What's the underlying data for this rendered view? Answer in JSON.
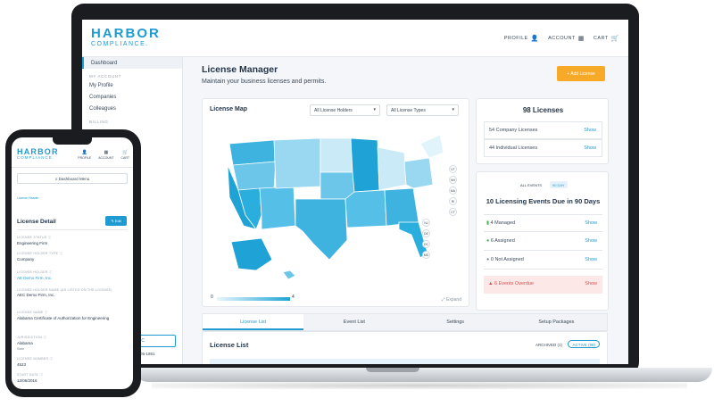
{
  "brand": {
    "name": "HARBOR",
    "sub": "COMPLIANCE."
  },
  "topnav": {
    "profile": "PROFILE",
    "account": "ACCOUNT",
    "cart": "CART"
  },
  "sidebar": {
    "items": [
      "Dashboard"
    ],
    "section_account": "MY ACCOUNT",
    "account_items": [
      "My Profile",
      "Companies",
      "Colleagues"
    ],
    "section_billing": "BILLING"
  },
  "page": {
    "title": "License Manager",
    "subtitle": "Maintain your business licenses and permits.",
    "add_button": "+ Add License"
  },
  "map_card": {
    "title": "License Map",
    "filter_holders": "All License Holders",
    "filter_types": "All License Types",
    "legend_min": "0",
    "legend_max": "4",
    "expand": "Expand",
    "state_badges": [
      "VT",
      "NH",
      "MA",
      "RI",
      "CT",
      "NJ",
      "DE",
      "DC",
      "MD"
    ]
  },
  "licenses": {
    "total": "98 Licenses",
    "rows": [
      {
        "label": "54 Company Licenses",
        "action": "Show"
      },
      {
        "label": "44 Individual Licenses",
        "action": "Show"
      }
    ]
  },
  "events": {
    "pill_all": "ALL EVENTS",
    "pill_90": "90 DAY",
    "title": "10 Licensing Events Due in 90 Days",
    "rows": [
      {
        "label": "4 Managed",
        "action": "Show"
      },
      {
        "label": "6 Assigned",
        "action": "Show"
      },
      {
        "label": "0 Not Assigned",
        "action": "Show"
      }
    ],
    "overdue": {
      "label": "6 Events Overdue",
      "action": "Show"
    }
  },
  "tabs": [
    "License List",
    "Event List",
    "Settings",
    "Setup Packages"
  ],
  "license_list": {
    "title": "License List",
    "archived": "ARCHIVED (1)",
    "active": "ACTIVE (98)"
  },
  "peek": {
    "button_text": "SC",
    "phone_text": "05-1881"
  },
  "phone": {
    "nav": {
      "profile": "PROFILE",
      "account": "ACCOUNT",
      "cart": "CART"
    },
    "menu": "≡  Dashboard Menu",
    "breadcrumb": "License Header",
    "title": "License Detail",
    "edit": "✎ Edit",
    "fields": [
      {
        "label": "LICENSE STATUS ⓘ",
        "value": "Engineering Firm"
      },
      {
        "label": "LICENSE HOLDER TYPE ⓘ",
        "value": "Company"
      },
      {
        "label": "LICENSE HOLDER ⓘ",
        "value": "AE Demo Firm, Inc.",
        "link": true
      },
      {
        "label": "LICENSE HOLDER NAME (AS LISTED ON THE LICENSE)",
        "value": "AEC Demo Firm, Inc."
      },
      {
        "label": "LICENSE NAME ⓘ",
        "value": "Alabama Certificate of Authorization for Engineering"
      },
      {
        "label": "JURISDICTION ⓘ",
        "value": "Alabama"
      },
      {
        "label": "LICENSE NUMBER ⓘ",
        "value": "4523"
      },
      {
        "label": "START DATE ⓘ",
        "value": "12/06/2016"
      }
    ],
    "jurisdiction_sub": "State"
  }
}
